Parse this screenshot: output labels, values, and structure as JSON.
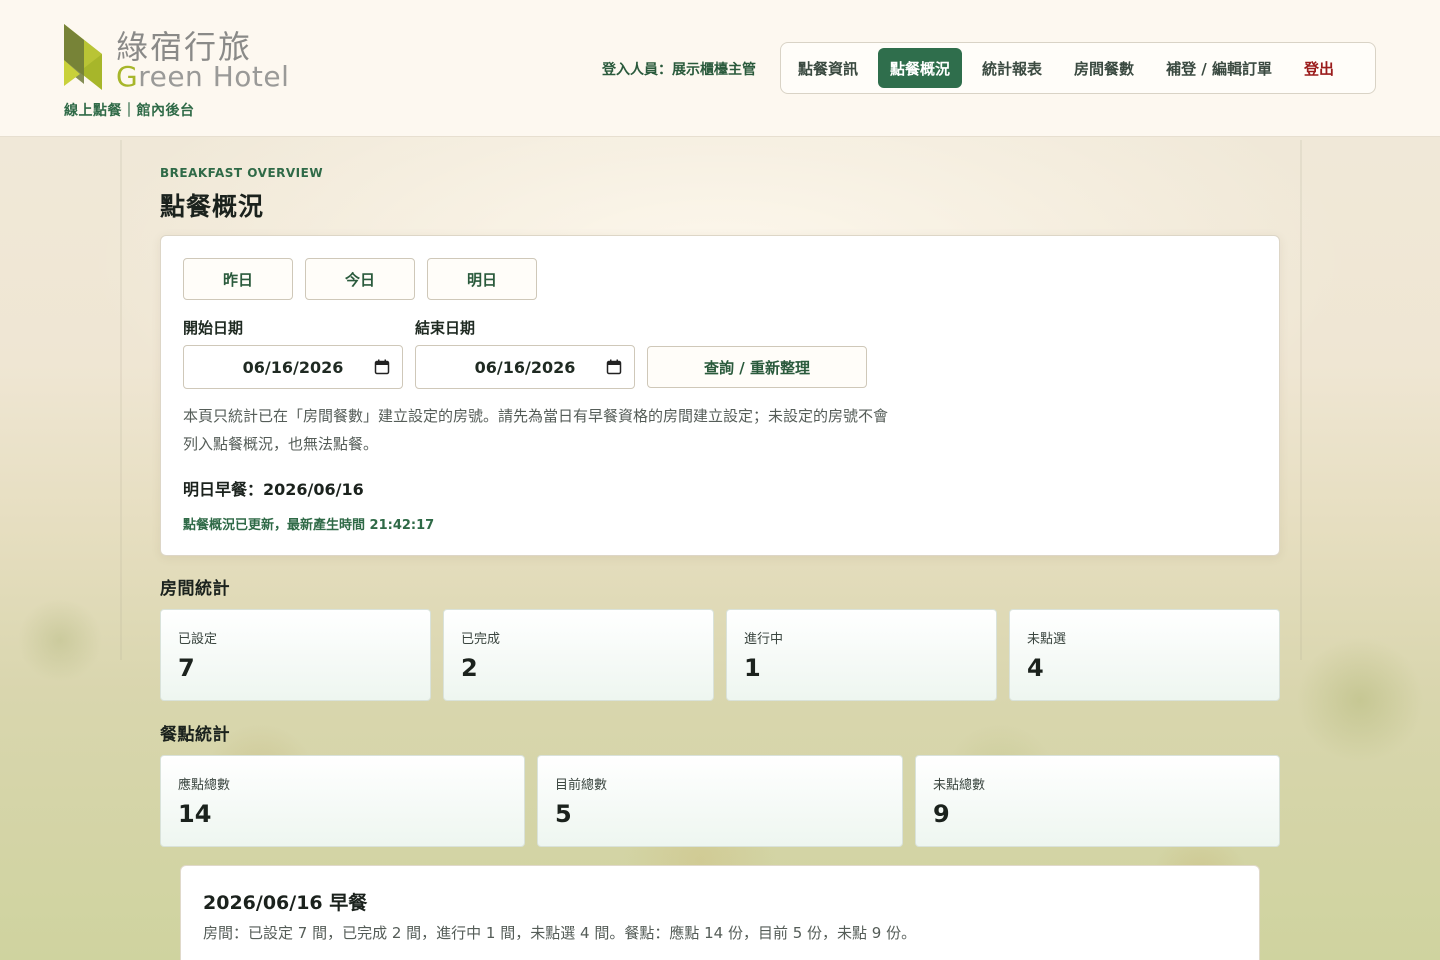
{
  "brand": {
    "name_zh": "綠宿行旅",
    "name_en_initial": "G",
    "name_en_rest": "reen Hotel",
    "subtitle": "線上點餐｜館內後台",
    "color_primary": "#2f6e4c",
    "color_logo_green": "#a7b62a"
  },
  "header": {
    "login_user": "登入人員：展示櫃檯主管"
  },
  "nav": {
    "items": [
      {
        "label": "點餐資訊",
        "active": false
      },
      {
        "label": "點餐概況",
        "active": true
      },
      {
        "label": "統計報表",
        "active": false
      },
      {
        "label": "房間餐數",
        "active": false
      },
      {
        "label": "補登 / 編輯訂單",
        "active": false
      }
    ],
    "logout": "登出"
  },
  "page": {
    "eyebrow": "BREAKFAST OVERVIEW",
    "title": "點餐概況"
  },
  "filters": {
    "quick": [
      "昨日",
      "今日",
      "明日"
    ],
    "start_label": "開始日期",
    "end_label": "結束日期",
    "start_value": "06/16/2026",
    "end_value": "06/16/2026",
    "query_button": "查詢 / 重新整理",
    "notice_line1": "本頁只統計已在「房間餐數」建立設定的房號。請先為當日有早餐資格的房間建立設定；未設定的房號不會",
    "notice_line2": "列入點餐概況，也無法點餐。",
    "next_day": "明日早餐：2026/06/16",
    "update_status": "點餐概況已更新，最新產生時間 21:42:17"
  },
  "room_stats": {
    "title": "房間統計",
    "items": [
      {
        "label": "已設定",
        "value": "7"
      },
      {
        "label": "已完成",
        "value": "2"
      },
      {
        "label": "進行中",
        "value": "1"
      },
      {
        "label": "未點選",
        "value": "4"
      }
    ]
  },
  "meal_stats": {
    "title": "餐點統計",
    "items": [
      {
        "label": "應點總數",
        "value": "14"
      },
      {
        "label": "目前總數",
        "value": "5"
      },
      {
        "label": "未點總數",
        "value": "9"
      }
    ]
  },
  "summary": {
    "title": "2026/06/16 早餐",
    "text": "房間：已設定 7 間，已完成 2 間，進行中 1 間，未點選 4 間。餐點：應點 14 份，目前 5 份，未點 9 份。"
  }
}
